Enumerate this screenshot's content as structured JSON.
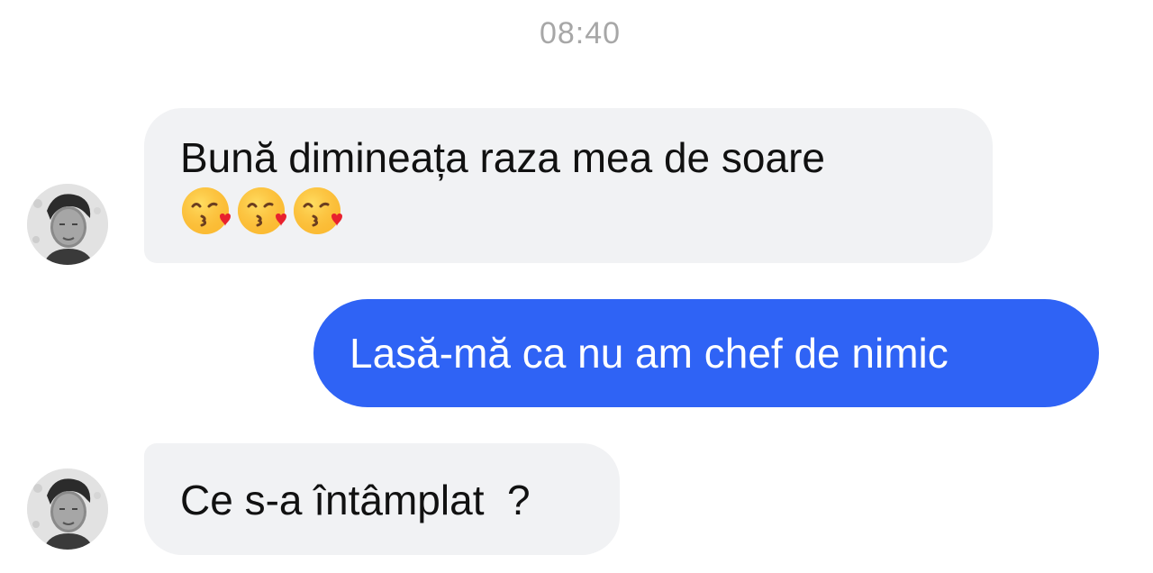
{
  "timestamp": "08:40",
  "messages": [
    {
      "direction": "incoming",
      "text": "Bună dimineața raza mea de soare",
      "emojis": [
        "kissing-heart-emoji",
        "kissing-heart-emoji",
        "kissing-heart-emoji"
      ]
    },
    {
      "direction": "outgoing",
      "text": "Lasă-mă ca nu am chef de nimic"
    },
    {
      "direction": "incoming",
      "text": "Ce s-a întâmplat  ?"
    }
  ],
  "colors": {
    "outgoing_bubble": "#2f63f5",
    "incoming_bubble": "#f1f2f4",
    "timestamp_text": "#a7a7a7"
  }
}
